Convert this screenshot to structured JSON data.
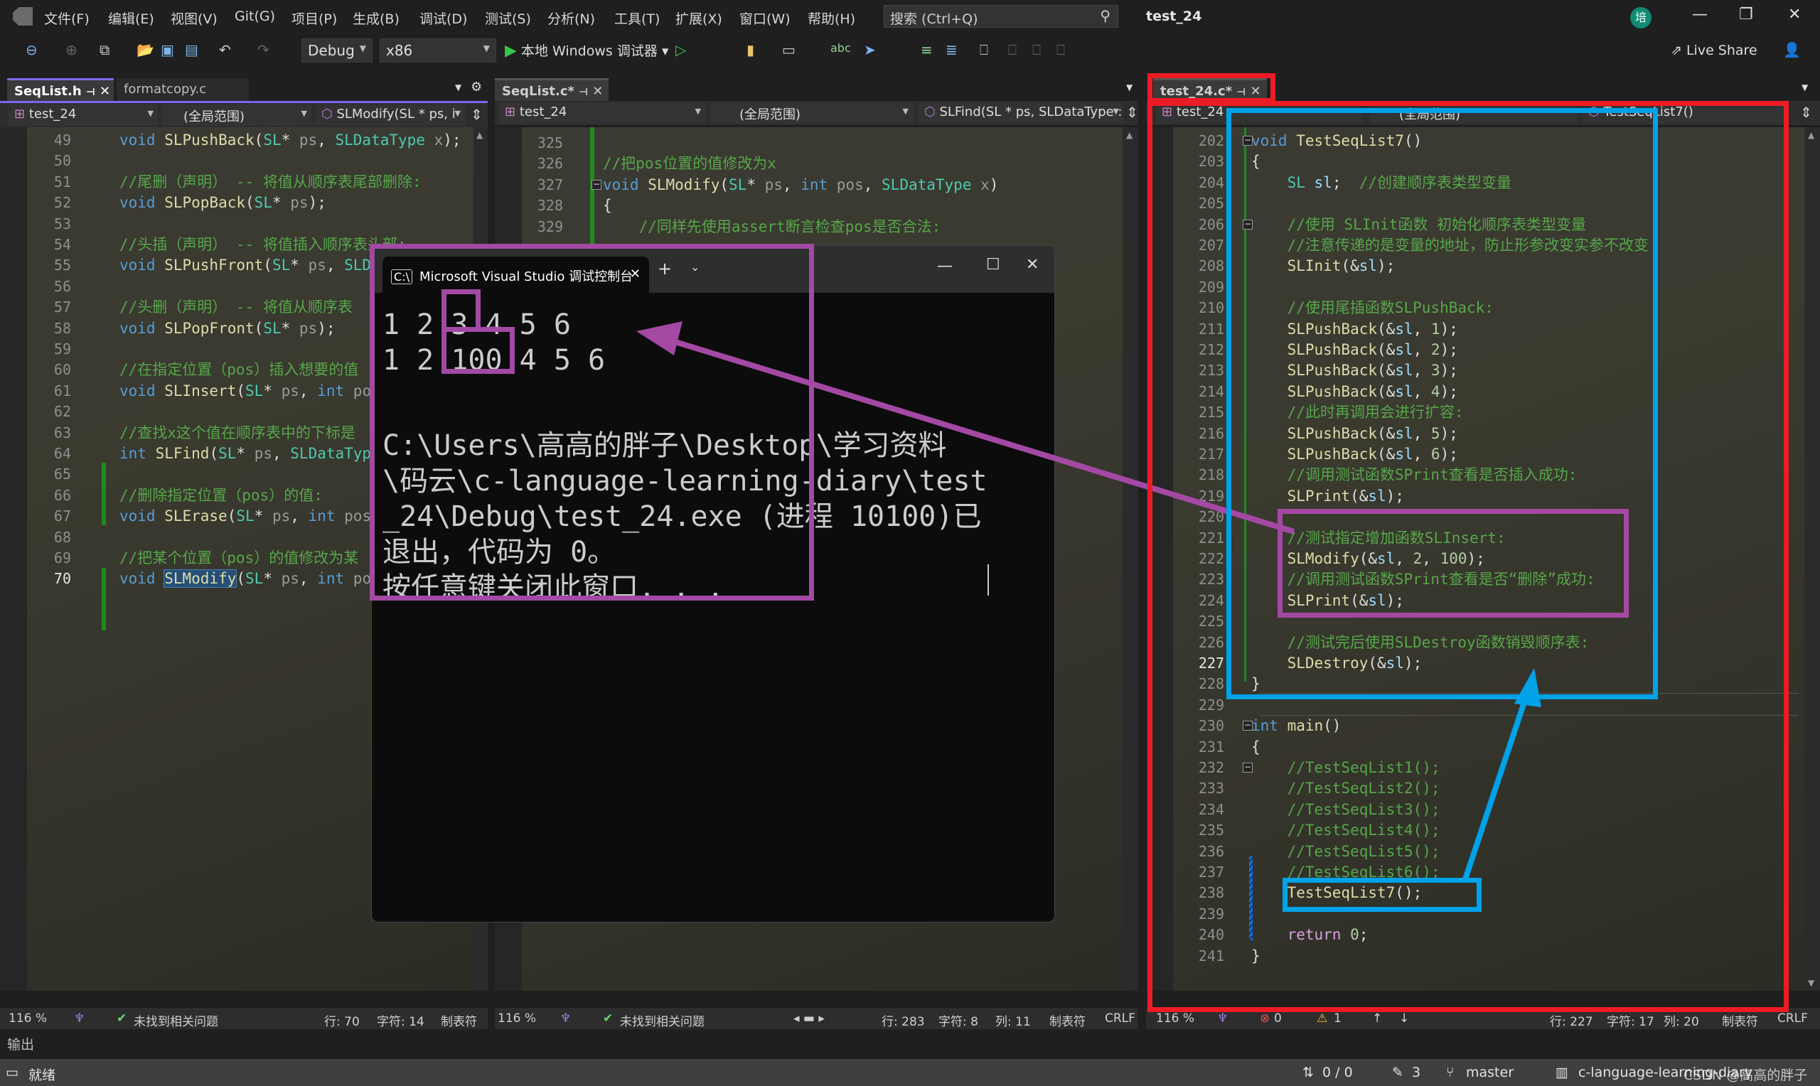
{
  "menu": {
    "items": [
      "文件(F)",
      "编辑(E)",
      "视图(V)",
      "Git(G)",
      "项目(P)",
      "生成(B)",
      "调试(D)",
      "测试(S)",
      "分析(N)",
      "工具(T)",
      "扩展(X)",
      "窗口(W)",
      "帮助(H)"
    ],
    "search_placeholder": "搜索 (Ctrl+Q)",
    "window_title": "test_24",
    "avatar_initial": "培"
  },
  "toolbar": {
    "configuration": "Debug",
    "platform": "x86",
    "run_label": "本地 Windows 调试器",
    "live_share": "Live Share"
  },
  "left_pane": {
    "tabs": [
      {
        "label": "SeqList.h",
        "active": true
      },
      {
        "label": "formatcopy.c",
        "active": false
      }
    ],
    "nav": {
      "project": "test_24",
      "scope": "(全局范围)",
      "member": "SLModify(SL * ps, i"
    },
    "lines": [
      {
        "n": "49",
        "code": [
          [
            "kw",
            "void "
          ],
          [
            "fn",
            "SLPushBack"
          ],
          [
            "pl",
            "("
          ],
          [
            "ty",
            "SL"
          ],
          [
            "pl",
            "* "
          ],
          [
            "pm",
            "ps"
          ],
          [
            "pl",
            ", "
          ],
          [
            "ty",
            "SLDataType"
          ],
          [
            "pm",
            " x"
          ],
          [
            "pl",
            ");"
          ]
        ]
      },
      {
        "n": "50",
        "code": []
      },
      {
        "n": "51",
        "code": [
          [
            "cm",
            "//尾删（声明） -- 将值从顺序表尾部删除:"
          ]
        ]
      },
      {
        "n": "52",
        "code": [
          [
            "kw",
            "void "
          ],
          [
            "fn",
            "SLPopBack"
          ],
          [
            "pl",
            "("
          ],
          [
            "ty",
            "SL"
          ],
          [
            "pl",
            "* "
          ],
          [
            "pm",
            "ps"
          ],
          [
            "pl",
            ");"
          ]
        ]
      },
      {
        "n": "53",
        "code": []
      },
      {
        "n": "54",
        "code": [
          [
            "cm",
            "//头插（声明） -- 将值插入顺序表头部:"
          ]
        ]
      },
      {
        "n": "55",
        "code": [
          [
            "kw",
            "void "
          ],
          [
            "fn",
            "SLPushFront"
          ],
          [
            "pl",
            "("
          ],
          [
            "ty",
            "SL"
          ],
          [
            "pl",
            "* "
          ],
          [
            "pm",
            "ps"
          ],
          [
            "pl",
            ", "
          ],
          [
            "ty",
            "SLD"
          ]
        ]
      },
      {
        "n": "56",
        "code": []
      },
      {
        "n": "57",
        "code": [
          [
            "cm",
            "//头删（声明） -- 将值从顺序表"
          ]
        ]
      },
      {
        "n": "58",
        "code": [
          [
            "kw",
            "void "
          ],
          [
            "fn",
            "SLPopFront"
          ],
          [
            "pl",
            "("
          ],
          [
            "ty",
            "SL"
          ],
          [
            "pl",
            "* "
          ],
          [
            "pm",
            "ps"
          ],
          [
            "pl",
            ");"
          ]
        ]
      },
      {
        "n": "59",
        "code": []
      },
      {
        "n": "60",
        "code": [
          [
            "cm",
            "//在指定位置（pos）插入想要的值"
          ]
        ]
      },
      {
        "n": "61",
        "code": [
          [
            "kw",
            "void "
          ],
          [
            "fn",
            "SLInsert"
          ],
          [
            "pl",
            "("
          ],
          [
            "ty",
            "SL"
          ],
          [
            "pl",
            "* "
          ],
          [
            "pm",
            "ps"
          ],
          [
            "pl",
            ", "
          ],
          [
            "kw",
            "int "
          ],
          [
            "pm",
            "po"
          ]
        ]
      },
      {
        "n": "62",
        "code": []
      },
      {
        "n": "63",
        "code": [
          [
            "cm",
            "//查找x这个值在顺序表中的下标是"
          ]
        ]
      },
      {
        "n": "64",
        "code": [
          [
            "kw",
            "int "
          ],
          [
            "fn",
            "SLFind"
          ],
          [
            "pl",
            "("
          ],
          [
            "ty",
            "SL"
          ],
          [
            "pl",
            "* "
          ],
          [
            "pm",
            "ps"
          ],
          [
            "pl",
            ", "
          ],
          [
            "ty",
            "SLDataTyp"
          ]
        ]
      },
      {
        "n": "65",
        "code": []
      },
      {
        "n": "66",
        "code": [
          [
            "cm",
            "//删除指定位置（pos）的值:"
          ]
        ]
      },
      {
        "n": "67",
        "code": [
          [
            "kw",
            "void "
          ],
          [
            "fn",
            "SLErase"
          ],
          [
            "pl",
            "("
          ],
          [
            "ty",
            "SL"
          ],
          [
            "pl",
            "* "
          ],
          [
            "pm",
            "ps"
          ],
          [
            "pl",
            ", "
          ],
          [
            "kw",
            "int "
          ],
          [
            "pm",
            "pos"
          ]
        ]
      },
      {
        "n": "68",
        "code": []
      },
      {
        "n": "69",
        "code": [
          [
            "cm",
            "//把某个位置（pos）的值修改为某"
          ]
        ]
      },
      {
        "n": "70",
        "code": [
          [
            "kw",
            "void "
          ],
          [
            "fn",
            "SLModify"
          ],
          [
            "pl",
            "("
          ],
          [
            "ty",
            "SL"
          ],
          [
            "pl",
            "* "
          ],
          [
            "pm",
            "ps"
          ],
          [
            "pl",
            ", "
          ],
          [
            "kw",
            "int "
          ],
          [
            "pm",
            "po"
          ]
        ]
      }
    ],
    "current_line": "70",
    "status": {
      "zoom": "116 %",
      "issues": "未找到相关问题",
      "row": "行: 70",
      "char": "字符: 14",
      "tabs": "制表符"
    }
  },
  "middle_pane": {
    "tabs": [
      {
        "label": "SeqList.c*",
        "active": true
      }
    ],
    "nav": {
      "project": "test_24",
      "scope": "(全局范围)",
      "member": "SLFind(SL * ps, SLDataType :"
    },
    "lines": [
      {
        "n": "325",
        "code": []
      },
      {
        "n": "326",
        "code": [
          [
            "cm",
            "//把pos位置的值修改为x"
          ]
        ]
      },
      {
        "n": "327",
        "code": [
          [
            "kw",
            "void "
          ],
          [
            "fn",
            "SLModify"
          ],
          [
            "pl",
            "("
          ],
          [
            "ty",
            "SL"
          ],
          [
            "pl",
            "* "
          ],
          [
            "pm",
            "ps"
          ],
          [
            "pl",
            ", "
          ],
          [
            "kw",
            "int "
          ],
          [
            "pm",
            "pos"
          ],
          [
            "pl",
            ", "
          ],
          [
            "ty",
            "SLDataType"
          ],
          [
            "pm",
            " x"
          ],
          [
            "pl",
            ")"
          ]
        ]
      },
      {
        "n": "328",
        "code": [
          [
            "pl",
            "{"
          ]
        ]
      },
      {
        "n": "329",
        "code": [
          [
            "cm",
            "    //同样先使用assert断言检查pos是否合法:"
          ]
        ]
      }
    ],
    "status": {
      "zoom": "116 %",
      "issues": "未找到相关问题",
      "row": "行: 283",
      "char": "字符: 8",
      "col": "列: 11",
      "tabs": "制表符",
      "eol": "CRLF"
    }
  },
  "right_pane": {
    "tabs": [
      {
        "label": "test_24.c*",
        "active": true
      }
    ],
    "nav": {
      "project": "test_24",
      "scope": "(全局范围)",
      "member": "TestSeqList7()"
    },
    "lines": [
      {
        "n": "202",
        "code": [
          [
            "kw",
            "void "
          ],
          [
            "fn",
            "TestSeqList7"
          ],
          [
            "pl",
            "()"
          ]
        ]
      },
      {
        "n": "203",
        "code": [
          [
            "pl",
            "{"
          ]
        ]
      },
      {
        "n": "204",
        "code": [
          [
            "ty",
            "    SL "
          ],
          [
            "vr",
            "sl"
          ],
          [
            "pl",
            ";  "
          ],
          [
            "cm",
            "//创建顺序表类型变量"
          ]
        ]
      },
      {
        "n": "205",
        "code": []
      },
      {
        "n": "206",
        "code": [
          [
            "cm",
            "    //使用 SLInit函数 初始化顺序表类型变量"
          ]
        ]
      },
      {
        "n": "207",
        "code": [
          [
            "cm",
            "    //注意传递的是变量的地址，防止形参改变实参不改变"
          ]
        ]
      },
      {
        "n": "208",
        "code": [
          [
            "fn",
            "    SLInit"
          ],
          [
            "pl",
            "(&"
          ],
          [
            "vr",
            "sl"
          ],
          [
            "pl",
            ");"
          ]
        ]
      },
      {
        "n": "209",
        "code": []
      },
      {
        "n": "210",
        "code": [
          [
            "cm",
            "    //使用尾插函数SLPushBack:"
          ]
        ]
      },
      {
        "n": "211",
        "code": [
          [
            "fn",
            "    SLPushBack"
          ],
          [
            "pl",
            "(&"
          ],
          [
            "vr",
            "sl"
          ],
          [
            "pl",
            ", "
          ],
          [
            "nm",
            "1"
          ],
          [
            "pl",
            ");"
          ]
        ]
      },
      {
        "n": "212",
        "code": [
          [
            "fn",
            "    SLPushBack"
          ],
          [
            "pl",
            "(&"
          ],
          [
            "vr",
            "sl"
          ],
          [
            "pl",
            ", "
          ],
          [
            "nm",
            "2"
          ],
          [
            "pl",
            ");"
          ]
        ]
      },
      {
        "n": "213",
        "code": [
          [
            "fn",
            "    SLPushBack"
          ],
          [
            "pl",
            "(&"
          ],
          [
            "vr",
            "sl"
          ],
          [
            "pl",
            ", "
          ],
          [
            "nm",
            "3"
          ],
          [
            "pl",
            ");"
          ]
        ]
      },
      {
        "n": "214",
        "code": [
          [
            "fn",
            "    SLPushBack"
          ],
          [
            "pl",
            "(&"
          ],
          [
            "vr",
            "sl"
          ],
          [
            "pl",
            ", "
          ],
          [
            "nm",
            "4"
          ],
          [
            "pl",
            ");"
          ]
        ]
      },
      {
        "n": "215",
        "code": [
          [
            "cm",
            "    //此时再调用会进行扩容:"
          ]
        ]
      },
      {
        "n": "216",
        "code": [
          [
            "fn",
            "    SLPushBack"
          ],
          [
            "pl",
            "(&"
          ],
          [
            "vr",
            "sl"
          ],
          [
            "pl",
            ", "
          ],
          [
            "nm",
            "5"
          ],
          [
            "pl",
            ");"
          ]
        ]
      },
      {
        "n": "217",
        "code": [
          [
            "fn",
            "    SLPushBack"
          ],
          [
            "pl",
            "(&"
          ],
          [
            "vr",
            "sl"
          ],
          [
            "pl",
            ", "
          ],
          [
            "nm",
            "6"
          ],
          [
            "pl",
            ");"
          ]
        ]
      },
      {
        "n": "218",
        "code": [
          [
            "cm",
            "    //调用测试函数SPrint查看是否插入成功:"
          ]
        ]
      },
      {
        "n": "219",
        "code": [
          [
            "fn",
            "    SLPrint"
          ],
          [
            "pl",
            "(&"
          ],
          [
            "vr",
            "sl"
          ],
          [
            "pl",
            ");"
          ]
        ]
      },
      {
        "n": "220",
        "code": []
      },
      {
        "n": "221",
        "code": [
          [
            "cm",
            "    //测试指定增加函数SLInsert:"
          ]
        ]
      },
      {
        "n": "222",
        "code": [
          [
            "fn",
            "    SLModify"
          ],
          [
            "pl",
            "(&"
          ],
          [
            "vr",
            "sl"
          ],
          [
            "pl",
            ", "
          ],
          [
            "nm",
            "2"
          ],
          [
            "pl",
            ", "
          ],
          [
            "nm",
            "100"
          ],
          [
            "pl",
            ");"
          ]
        ]
      },
      {
        "n": "223",
        "code": [
          [
            "cm",
            "    //调用测试函数SPrint查看是否“删除”成功:"
          ]
        ]
      },
      {
        "n": "224",
        "code": [
          [
            "fn",
            "    SLPrint"
          ],
          [
            "pl",
            "(&"
          ],
          [
            "vr",
            "sl"
          ],
          [
            "pl",
            ");"
          ]
        ]
      },
      {
        "n": "225",
        "code": []
      },
      {
        "n": "226",
        "code": [
          [
            "cm",
            "    //测试完后使用SLDestroy函数销毁顺序表:"
          ]
        ]
      },
      {
        "n": "227",
        "code": [
          [
            "fn",
            "    SLDestroy"
          ],
          [
            "pl",
            "(&"
          ],
          [
            "vr",
            "sl"
          ],
          [
            "pl",
            ");"
          ]
        ]
      },
      {
        "n": "228",
        "code": [
          [
            "pl",
            "}"
          ]
        ]
      },
      {
        "n": "229",
        "code": []
      },
      {
        "n": "230",
        "code": [
          [
            "kw",
            "int "
          ],
          [
            "fn",
            "main"
          ],
          [
            "pl",
            "()"
          ]
        ]
      },
      {
        "n": "231",
        "code": [
          [
            "pl",
            "{"
          ]
        ]
      },
      {
        "n": "232",
        "code": [
          [
            "cm",
            "    //TestSeqList1();"
          ]
        ]
      },
      {
        "n": "233",
        "code": [
          [
            "cm",
            "    //TestSeqList2();"
          ]
        ]
      },
      {
        "n": "234",
        "code": [
          [
            "cm",
            "    //TestSeqList3();"
          ]
        ]
      },
      {
        "n": "235",
        "code": [
          [
            "cm",
            "    //TestSeqList4();"
          ]
        ]
      },
      {
        "n": "236",
        "code": [
          [
            "cm",
            "    //TestSeqList5();"
          ]
        ]
      },
      {
        "n": "237",
        "code": [
          [
            "cm",
            "    //TestSeqList6();"
          ]
        ]
      },
      {
        "n": "238",
        "code": [
          [
            "fn",
            "    TestSeqList7"
          ],
          [
            "pl",
            "();"
          ]
        ]
      },
      {
        "n": "239",
        "code": []
      },
      {
        "n": "240",
        "code": [
          [
            "ctl",
            "    return "
          ],
          [
            "nm",
            "0"
          ],
          [
            "pl",
            ";"
          ]
        ]
      },
      {
        "n": "241",
        "code": [
          [
            "pl",
            "}"
          ]
        ]
      }
    ],
    "current_line": "227",
    "status": {
      "zoom": "116 %",
      "errors": "0",
      "warnings": "1",
      "row": "行: 227",
      "char": "字符: 17",
      "col": "列: 20",
      "tabs": "制表符",
      "eol": "CRLF"
    }
  },
  "console": {
    "title": "Microsoft Visual Studio 调试控制台",
    "lines": [
      "1 2 3 4 5 6",
      "1 2 100 4 5 6",
      "",
      "C:\\Users\\高高的胖子\\Desktop\\学习资料",
      "\\码云\\c-language-learning-diary\\test",
      "_24\\Debug\\test_24.exe (进程 10100)已",
      "退出，代码为 0。",
      "按任意键关闭此窗口. . ."
    ]
  },
  "output_panel": {
    "label": "输出"
  },
  "bottom_status": {
    "ready": "就绪",
    "sync": "0 / 0",
    "edits": "3",
    "branch": "master",
    "repo": "c-language-learning-diary",
    "watermark": "CSDN @高高的胖子"
  },
  "annotation_colors": {
    "purple": "#a349a4",
    "red": "#ed1c24",
    "blue": "#00a2e8"
  }
}
